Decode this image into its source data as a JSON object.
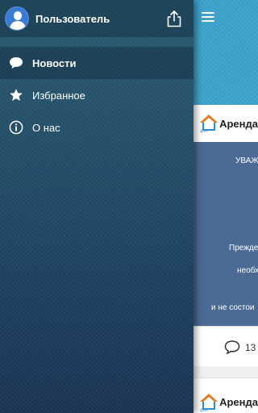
{
  "drawer": {
    "username": "Пользователь",
    "items": [
      {
        "label": "Новости",
        "icon": "speech-bubble-icon",
        "active": true
      },
      {
        "label": "Избранное",
        "icon": "star-icon",
        "active": false
      },
      {
        "label": "О нас",
        "icon": "info-icon",
        "active": false
      }
    ]
  },
  "feed": {
    "cards": [
      {
        "title": "Аренда",
        "body_lines": [
          "УВАЖ",
          "Прежде",
          "необх",
          "и не состои"
        ],
        "comment_count": "13"
      },
      {
        "title": "Аренда"
      }
    ]
  },
  "colors": {
    "drawer_top": "#2a5a71",
    "drawer_bottom": "#1a3352",
    "header_blue": "#3aa0c9",
    "card_body": "#4b6b94"
  }
}
